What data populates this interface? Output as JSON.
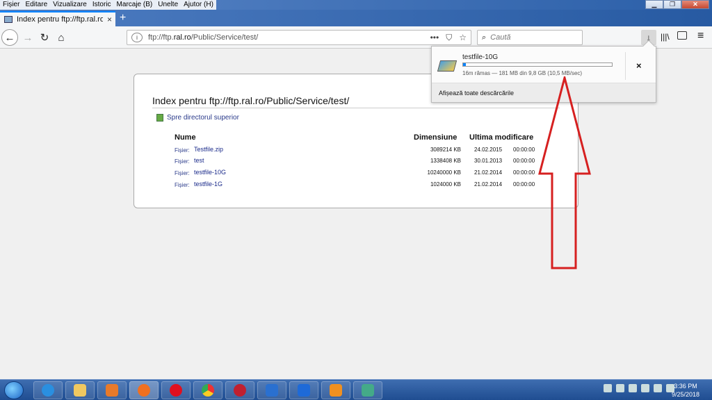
{
  "menubar": [
    "Fișier",
    "Editare",
    "Vizualizare",
    "Istoric",
    "Marcaje (B)",
    "Unelte",
    "Ajutor (H)"
  ],
  "tab": {
    "title": "Index pentru ftp://ftp.ral.ro/Pu",
    "close": "×"
  },
  "nav": {
    "url_prefix": "ftp://ftp.",
    "url_domain": "ral.ro",
    "url_path": "/Public/Service/test/",
    "search_placeholder": "Caută",
    "more": "•••"
  },
  "download": {
    "filename": "testfile-10G",
    "progress": 0.018,
    "status": "16m rămas — 181 MB din 9,8 GB (10,5 MB/sec)",
    "footer": "Afișează toate descărcările",
    "cancel": "×"
  },
  "page": {
    "title": "Index pentru ftp://ftp.ral.ro/Public/Service/test/",
    "parent_link": "Spre directorul superior",
    "headers": {
      "name": "Nume",
      "size": "Dimensiune",
      "date": "Ultima modificare"
    },
    "rows": [
      {
        "type": "Fișier:",
        "name": "Testfile.zip",
        "size": "3089214 KB",
        "date": "24.02.2015",
        "time": "00:00:00"
      },
      {
        "type": "Fișier:",
        "name": "test",
        "size": "1338408 KB",
        "date": "30.01.2013",
        "time": "00:00:00"
      },
      {
        "type": "Fișier:",
        "name": "testfile-10G",
        "size": "10240000 KB",
        "date": "21.02.2014",
        "time": "00:00:00"
      },
      {
        "type": "Fișier:",
        "name": "testfile-1G",
        "size": "1024000 KB",
        "date": "21.02.2014",
        "time": "00:00:00"
      }
    ]
  },
  "taskbar": {
    "time": "3:36 PM",
    "date": "9/25/2018",
    "apps": [
      "internet-explorer",
      "file-explorer",
      "media-player",
      "firefox",
      "opera",
      "chrome",
      "app-red",
      "app-a",
      "maxthon",
      "uc-browser",
      "app-monitor"
    ]
  },
  "colors": {
    "accent": "#0a84ff",
    "arrow": "#d62020",
    "link": "#1a2a8a"
  }
}
